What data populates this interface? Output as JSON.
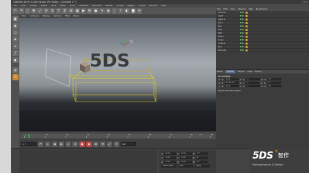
{
  "titlebar": {
    "title": "CINEMA 4D R13.016 Studio (RC Beta) - [Untitled 1 *]",
    "controls": "_ □ ×"
  },
  "menu": [
    "File",
    "Edit",
    "Create",
    "Select",
    "Tools",
    "Mesh",
    "Snap",
    "Animate",
    "Simulate",
    "Render",
    "Sculpt",
    "Plugins",
    "Script",
    "Window",
    "Help"
  ],
  "toolbar_icons": [
    "undo-icon",
    "redo-icon",
    "live-select-icon",
    "move-icon",
    "scale-icon",
    "rotate-icon",
    "x-axis-icon",
    "y-axis-icon",
    "z-axis-icon",
    "world-icon",
    "render-view-icon",
    "render-icon",
    "render-settings-icon",
    "cube-icon",
    "pen-icon",
    "subdivision-icon",
    "array-icon",
    "deformer-icon",
    "scene-icon",
    "camera-icon",
    "light-icon"
  ],
  "viewport": {
    "menu": [
      "View",
      "Cameras",
      "Display",
      "Options",
      "Filter",
      "Panel"
    ],
    "scene_text": "5DS"
  },
  "object_manager": {
    "menu": [
      "File",
      "Edit",
      "View",
      "Objects",
      "Tags",
      "Bookmarks"
    ],
    "rows": [
      "Camera",
      "Light",
      "Light.1",
      "Floor",
      "Sky",
      "Text",
      "5DS",
      "Plane",
      "Cube",
      "Cube.1",
      "Null",
      "Extrude"
    ]
  },
  "attributes": {
    "tabs": [
      "Basic",
      "Coord.",
      "Object",
      "Caps",
      "Phong"
    ],
    "active_tab": "Coord.",
    "section": "Coordinates",
    "rows": [
      {
        "label": "P . X",
        "value": "0 cm",
        "label2": "S . X",
        "value2": "1",
        "label3": "R . H",
        "value3": "0 °"
      },
      {
        "label": "P . Y",
        "value": "27.54 cm",
        "label2": "S . Y",
        "value2": "1",
        "label3": "R . P",
        "value3": "0 °"
      },
      {
        "label": "P . Z",
        "value": "0 cm",
        "label2": "S . Z",
        "value2": "1",
        "label3": "R . B",
        "value3": "0 °"
      }
    ],
    "section2": "Freeze Transformation"
  },
  "timeline": {
    "labels": [
      "0",
      "10",
      "20",
      "30",
      "40",
      "50",
      "60",
      "70",
      "80",
      "90"
    ],
    "current_frame": "0 F"
  },
  "transport": {
    "start": "0 F",
    "end": "90 F"
  },
  "coordinates": {
    "rows": [
      {
        "a": "X",
        "v1": "0 cm",
        "b": "X",
        "v2": "0 cm",
        "c": "H",
        "v3": "0 °"
      },
      {
        "a": "Y",
        "v1": "0 cm",
        "b": "Y",
        "v2": "0 cm",
        "c": "P",
        "v3": "0 °"
      },
      {
        "a": "Z",
        "v1": "0 cm",
        "b": "Z",
        "v2": "0 cm",
        "c": "B",
        "v3": "0 °"
      }
    ],
    "mode": "Object (Rel)",
    "size": "Size",
    "apply": "Apply"
  },
  "logo": {
    "mark": "5DS",
    "plus": "+",
    "cn": "智作",
    "sub": "Motiongraphics & Design"
  },
  "colors": {
    "accent": "#e8a318",
    "selection": "#f0d000",
    "record": "#b84a4a",
    "playhead": "#3ba14a"
  }
}
